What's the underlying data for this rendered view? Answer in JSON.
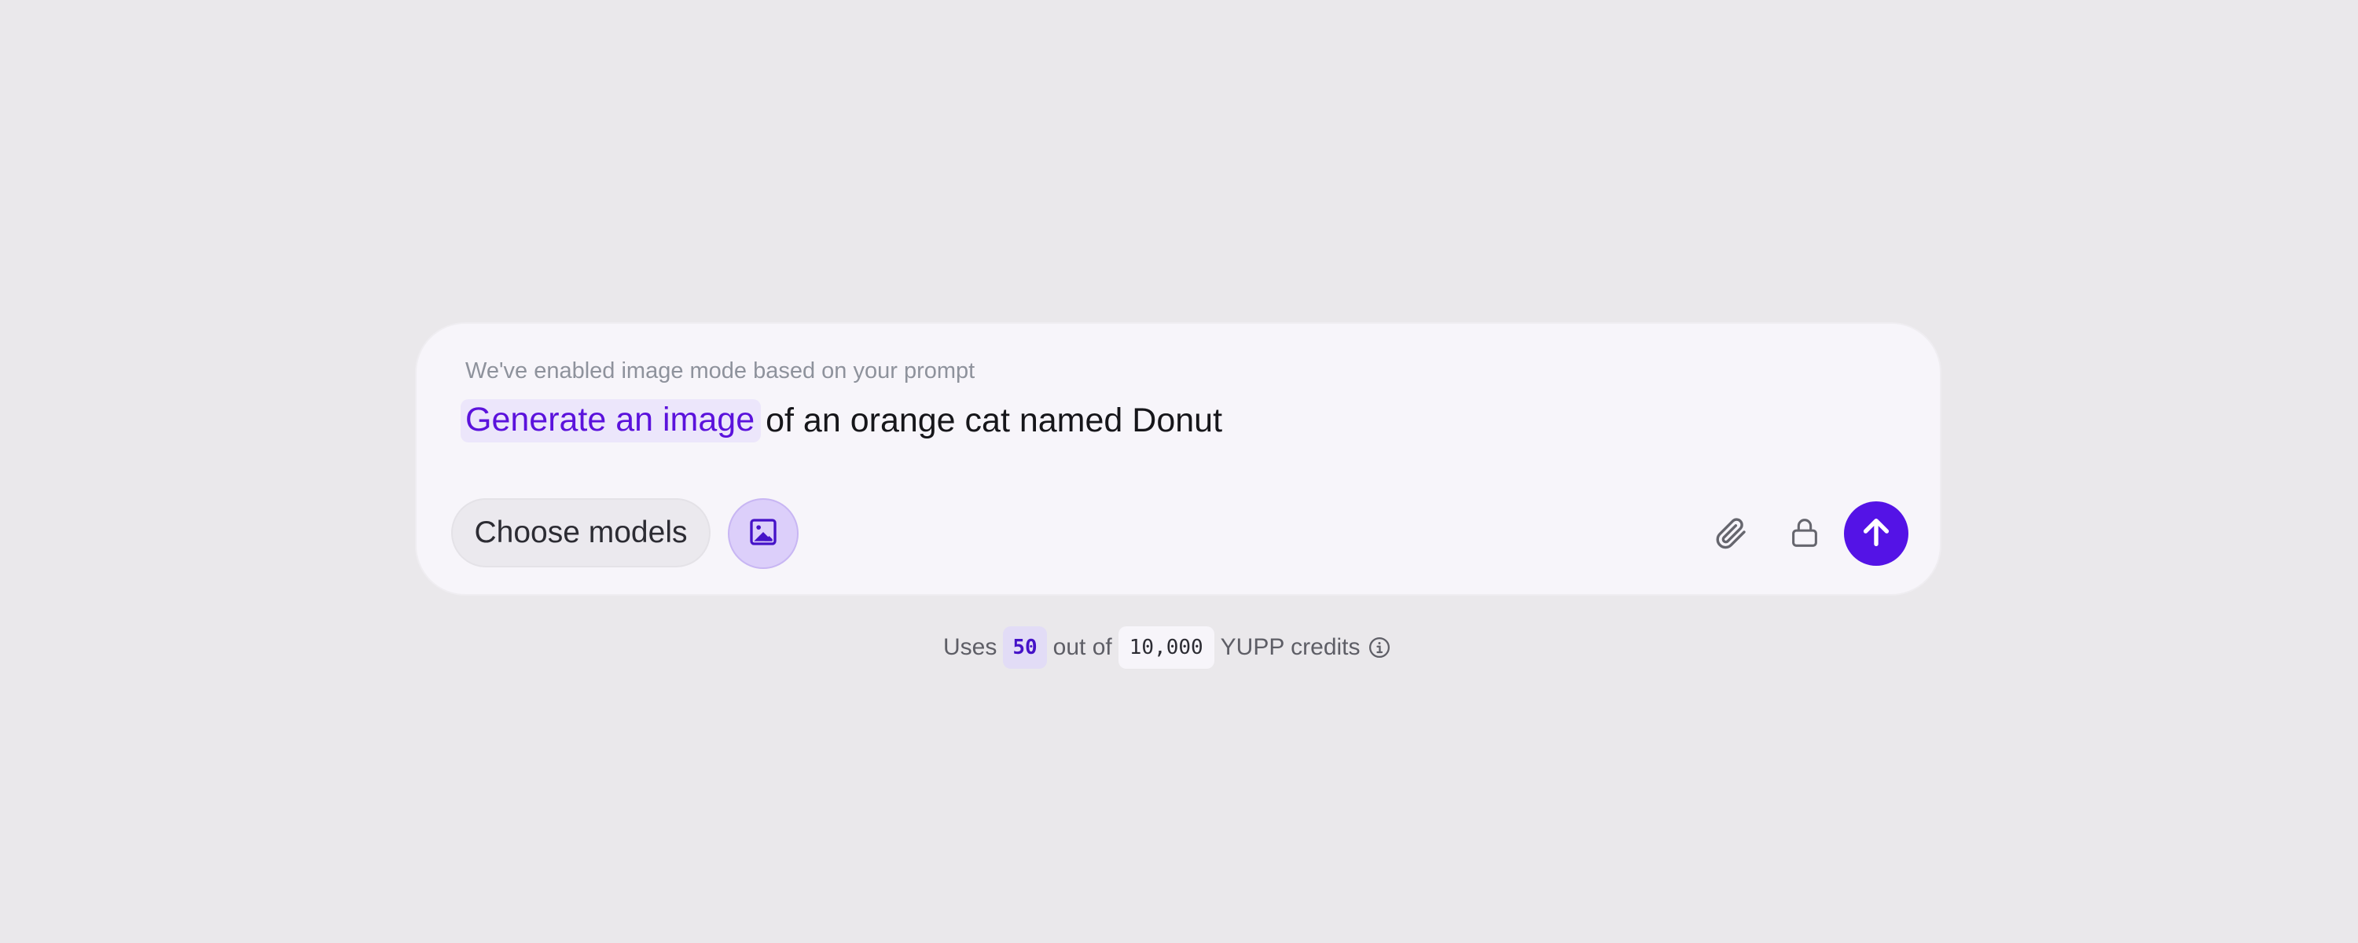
{
  "composer": {
    "hint": "We've enabled image mode based on your prompt",
    "prompt_highlight": "Generate an image",
    "prompt_rest": "of an orange cat named Donut",
    "choose_models_label": "Choose models",
    "image_mode_icon": "image-icon",
    "attach_icon": "paperclip-icon",
    "lock_icon": "lock-icon",
    "send_icon": "arrow-up-icon"
  },
  "credits": {
    "prefix": "Uses",
    "used": "50",
    "middle": "out of",
    "total": "10,000",
    "suffix": "YUPP credits",
    "info_icon": "info-icon"
  },
  "colors": {
    "background": "#eae8eb",
    "accent": "#5413e6",
    "highlight_text": "#5b12dc",
    "highlight_bg": "#ece6fb"
  }
}
